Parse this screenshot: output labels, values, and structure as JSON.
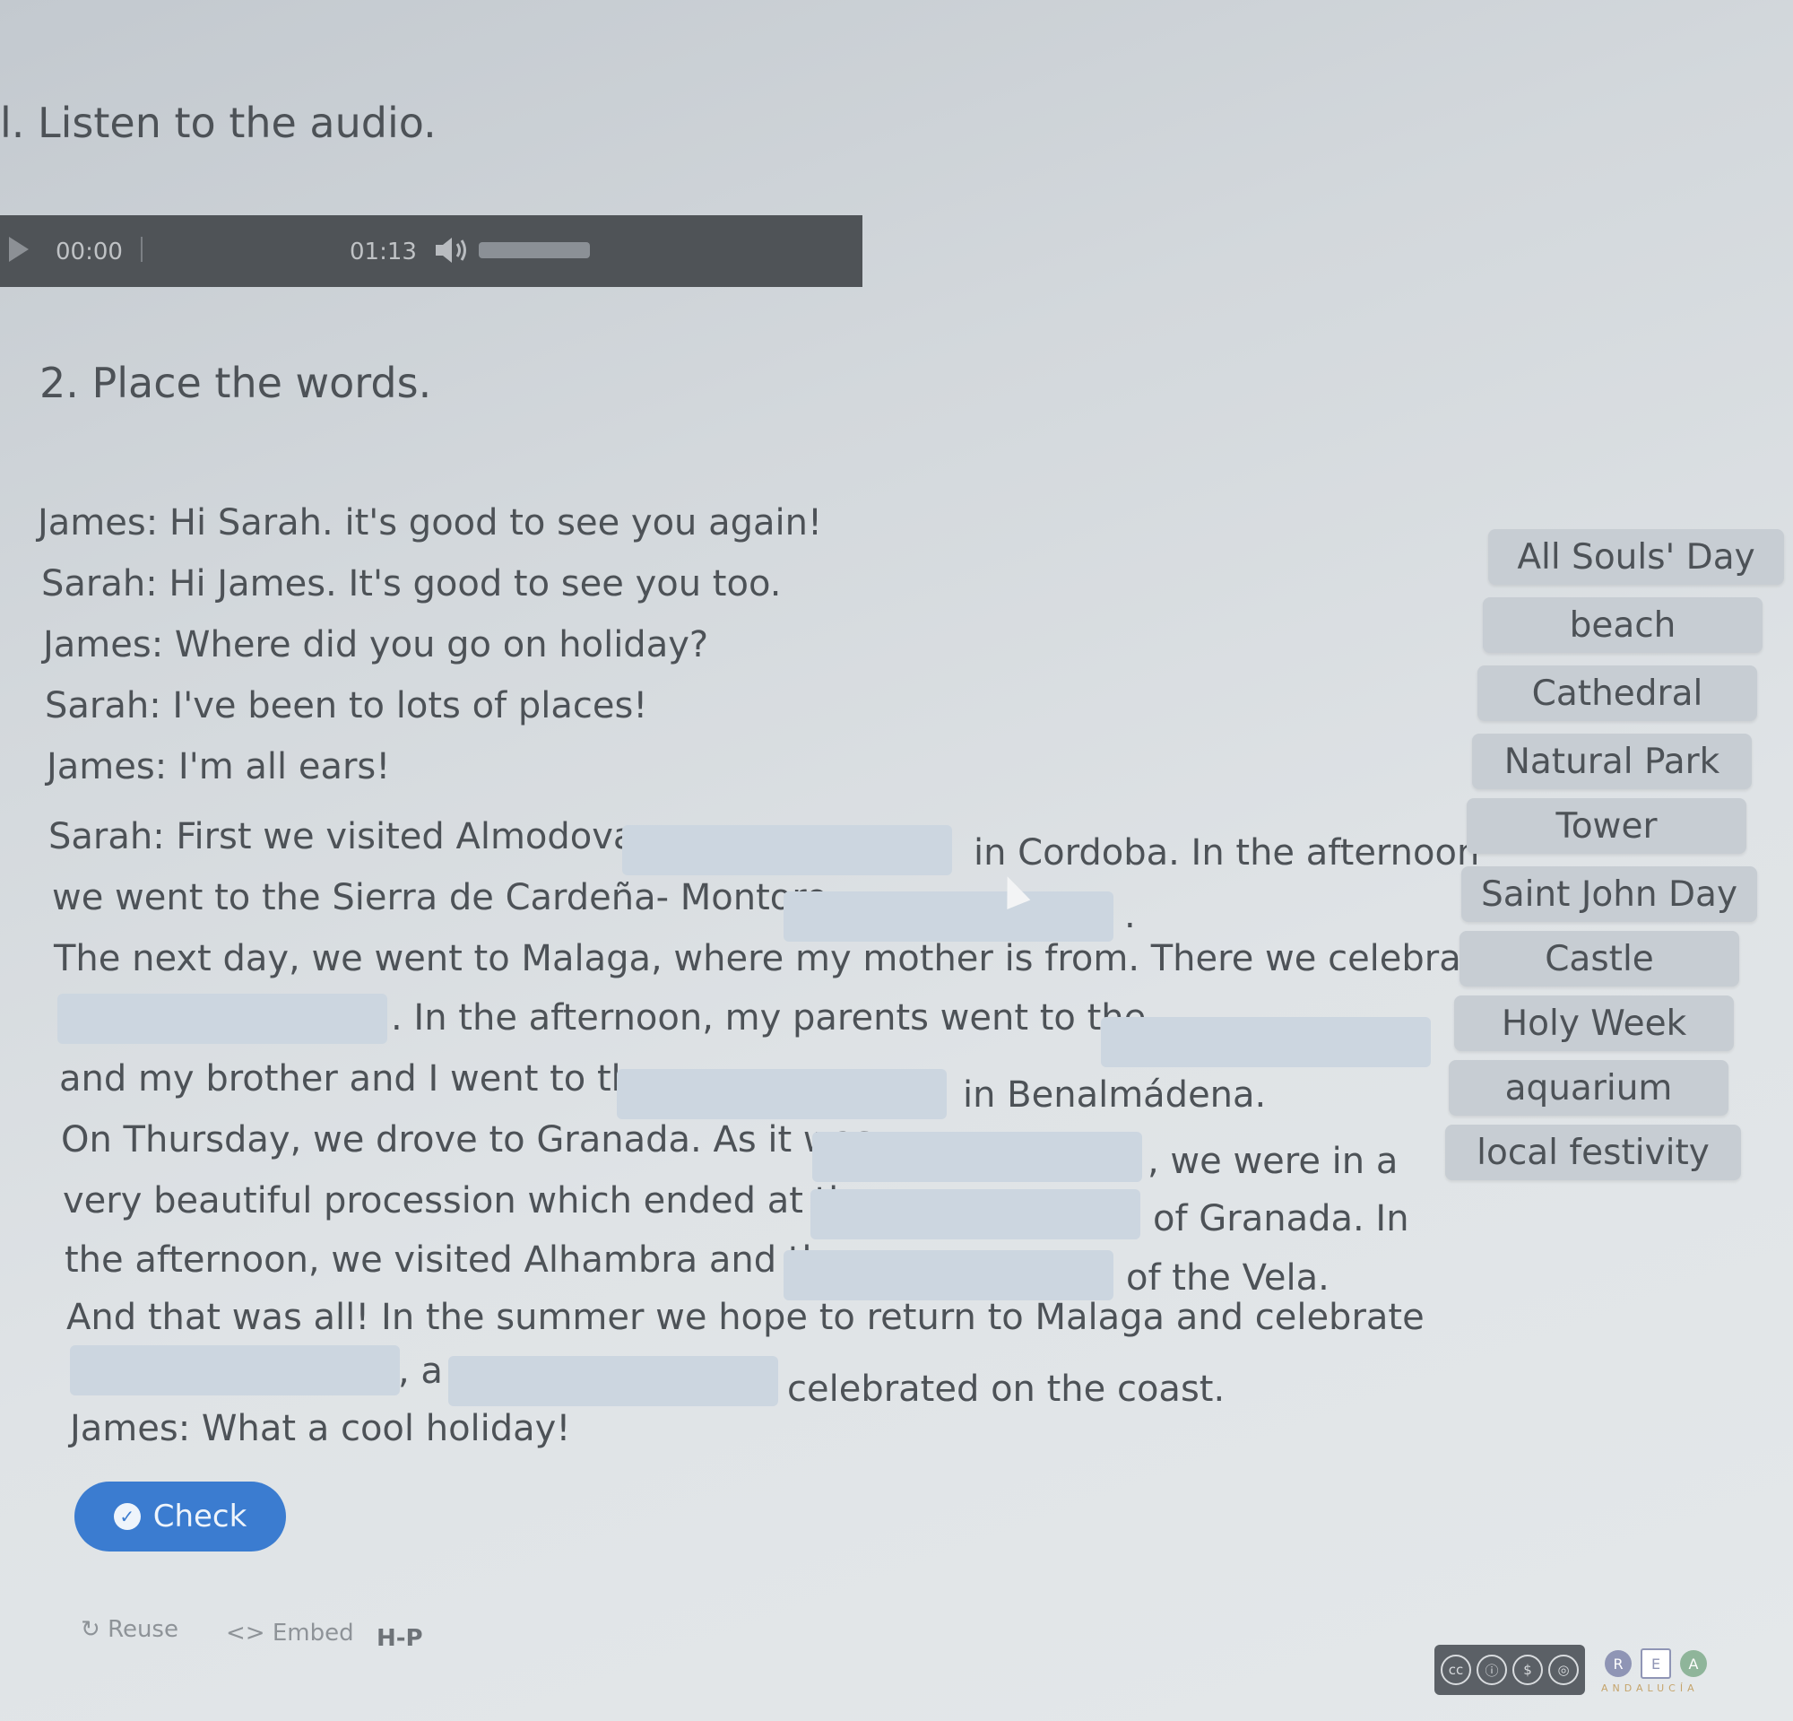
{
  "headings": {
    "listen": "l. Listen to the audio.",
    "place": "2. Place the words."
  },
  "audio": {
    "current_time": "00:00",
    "duration": "01:13"
  },
  "dialogue": {
    "l1": "James: Hi Sarah. it's good to see you again!",
    "l2": "Sarah: Hi James. It's good to see you too.",
    "l3": "James: Where did you go on holiday?",
    "l4": "Sarah: I've been to lots of places!",
    "l5": "James: I'm all ears!",
    "l6a": "Sarah: First we visited Almodovar",
    "l6b": "in Cordoba. In the afternoon",
    "l7a": "we went to the Sierra de Cardeña- Montoro",
    "l7b": ".",
    "l8": "The next day, we went to Malaga, where my mother is from. There we celebrated",
    "l9a": ". In the afternoon, my parents went to the",
    "l10a": "and my brother and I went to the",
    "l10b": "in Benalmádena.",
    "l11a": "On Thursday, we drove to Granada. As it was",
    "l11b": ", we were in a",
    "l12a": "very beautiful procession which ended at the",
    "l12b": "of Granada. In",
    "l13a": "the afternoon, we visited Alhambra and the",
    "l13b": "of the Vela.",
    "l14": "And that was all! In the summer we hope to return to Malaga and celebrate",
    "l15a": ", a",
    "l15b": "celebrated on the coast.",
    "l16": "James: What a cool holiday!"
  },
  "word_bank": [
    "All Souls' Day",
    "beach",
    "Cathedral",
    "Natural Park",
    "Tower",
    "Saint John Day",
    "Castle",
    "Holy Week",
    "aquarium",
    "local festivity"
  ],
  "buttons": {
    "check": "Check"
  },
  "footer": {
    "reuse": "Reuse",
    "embed": "Embed",
    "h5p": "H-P",
    "rea_sub": "ANDALUCÍA"
  },
  "colors": {
    "check_button": "#3b7cd0",
    "blank_fill": "#ccd6e0",
    "word_chip": "#c7cdd3"
  }
}
